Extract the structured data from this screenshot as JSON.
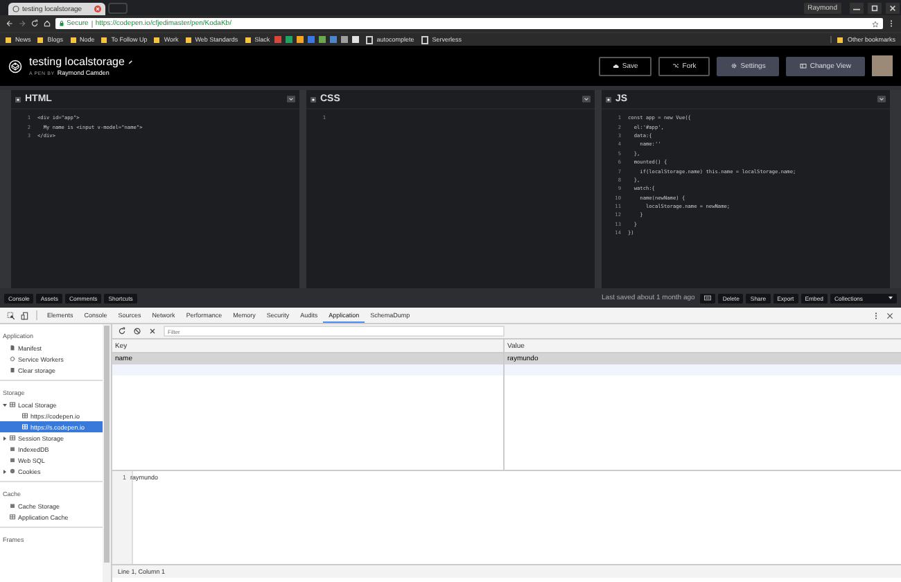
{
  "browser": {
    "tab_title": "testing localstorage",
    "user": "Raymond",
    "secure_label": "Secure",
    "url": "https://codepen.io/cfjedimaster/pen/KodaKb/",
    "bookmarks": [
      {
        "kind": "folder",
        "label": "News"
      },
      {
        "kind": "folder",
        "label": "Blogs"
      },
      {
        "kind": "folder",
        "label": "Node"
      },
      {
        "kind": "folder",
        "label": "To Follow Up"
      },
      {
        "kind": "folder",
        "label": "Work"
      },
      {
        "kind": "folder",
        "label": "Web Standards"
      },
      {
        "kind": "folder",
        "label": "Slack"
      },
      {
        "kind": "app",
        "color": "#d9453b"
      },
      {
        "kind": "app",
        "color": "#1fa463"
      },
      {
        "kind": "app",
        "color": "#f4a522"
      },
      {
        "kind": "app",
        "color": "#3b78e7"
      },
      {
        "kind": "app",
        "color": "#6aa84f"
      },
      {
        "kind": "app",
        "color": "#4a86c8"
      },
      {
        "kind": "app",
        "color": "#9e9e9e"
      },
      {
        "kind": "app",
        "color": "#e0e0e0"
      },
      {
        "kind": "page",
        "label": "autocomplete"
      },
      {
        "kind": "page",
        "label": "Serverless"
      }
    ],
    "other_bookmarks": "Other bookmarks"
  },
  "pen": {
    "title": "testing localstorage",
    "byline": "A PEN BY",
    "author": "Raymond Camden",
    "buttons": [
      {
        "label": "Save",
        "kind": "outline"
      },
      {
        "label": "Fork",
        "kind": "outline"
      },
      {
        "label": "Settings",
        "kind": "filled"
      },
      {
        "label": "Change View",
        "kind": "filled"
      }
    ]
  },
  "editors": [
    {
      "title": "HTML",
      "lines": [
        {
          "n": "1",
          "text": "<div id=\"app\">"
        },
        {
          "n": "2",
          "text": "  My name is <input v-model=\"name\">"
        },
        {
          "n": "3",
          "text": "</div>"
        }
      ]
    },
    {
      "title": "CSS",
      "lines": [
        {
          "n": "1"
        }
      ]
    },
    {
      "title": "JS",
      "lines": [
        {
          "n": "1",
          "text": "const app = new Vue({"
        },
        {
          "n": "2",
          "text": "  el:'#app',"
        },
        {
          "n": "3",
          "text": "  data:{"
        },
        {
          "n": "4",
          "text": "    name:''"
        },
        {
          "n": "5",
          "text": "  },"
        },
        {
          "n": "6",
          "text": "  mounted() {"
        },
        {
          "n": "7",
          "text": "    if(localStorage.name) this.name = localStorage.name;"
        },
        {
          "n": "8",
          "text": "  },"
        },
        {
          "n": "9",
          "text": "  watch:{"
        },
        {
          "n": "10",
          "text": "    name(newName) {"
        },
        {
          "n": "11",
          "text": "      localStorage.name = newName;"
        },
        {
          "n": "12",
          "text": "    }"
        },
        {
          "n": "13",
          "text": "  }"
        },
        {
          "n": "14",
          "text": "})"
        }
      ]
    }
  ],
  "bottom_bar": {
    "left_buttons": [
      "Console",
      "Assets",
      "Comments",
      "Shortcuts"
    ],
    "last_saved": "Last saved about 1 month ago",
    "right_buttons": [
      "Delete",
      "Share",
      "Export",
      "Embed"
    ],
    "collections": "Collections"
  },
  "devtools": {
    "tabs": [
      {
        "label": "Elements",
        "selected": false
      },
      {
        "label": "Console",
        "selected": false
      },
      {
        "label": "Sources",
        "selected": false
      },
      {
        "label": "Network",
        "selected": false
      },
      {
        "label": "Performance",
        "selected": false
      },
      {
        "label": "Memory",
        "selected": false
      },
      {
        "label": "Security",
        "selected": false
      },
      {
        "label": "Audits",
        "selected": false
      },
      {
        "label": "Application",
        "selected": true
      },
      {
        "label": "SchemaDump",
        "selected": false
      }
    ],
    "sidebar": [
      {
        "heading": "Application",
        "items": [
          {
            "label": "Manifest",
            "kind": "file",
            "selected": false
          },
          {
            "label": "Service Workers",
            "kind": "gear",
            "selected": false
          },
          {
            "label": "Clear storage",
            "kind": "bin",
            "selected": false
          }
        ]
      },
      {
        "heading": "Storage",
        "items": [
          {
            "label": "Local Storage",
            "kind": "grid",
            "selected": false,
            "expanded": true,
            "children": [
              {
                "label": "https://codepen.io",
                "selected": false
              },
              {
                "label": "https://s.codepen.io",
                "selected": true
              }
            ]
          },
          {
            "label": "Session Storage",
            "kind": "grid",
            "selected": false,
            "expanded": false
          },
          {
            "label": "IndexedDB",
            "kind": "db",
            "selected": false
          },
          {
            "label": "Web SQL",
            "kind": "db",
            "selected": false
          },
          {
            "label": "Cookies",
            "kind": "cookie",
            "selected": false,
            "expanded": false
          }
        ]
      },
      {
        "heading": "Cache",
        "items": [
          {
            "label": "Cache Storage",
            "kind": "db",
            "selected": false
          },
          {
            "label": "Application Cache",
            "kind": "grid",
            "selected": false
          }
        ]
      },
      {
        "heading": "Frames"
      }
    ],
    "filter_placeholder": "Filter",
    "columns": [
      "Key",
      "Value"
    ],
    "rows": [
      {
        "key": "name",
        "value": "raymundo",
        "selected": true
      }
    ],
    "preview": [
      {
        "n": "1",
        "text": "raymundo"
      }
    ],
    "status": "Line 1, Column 1"
  }
}
